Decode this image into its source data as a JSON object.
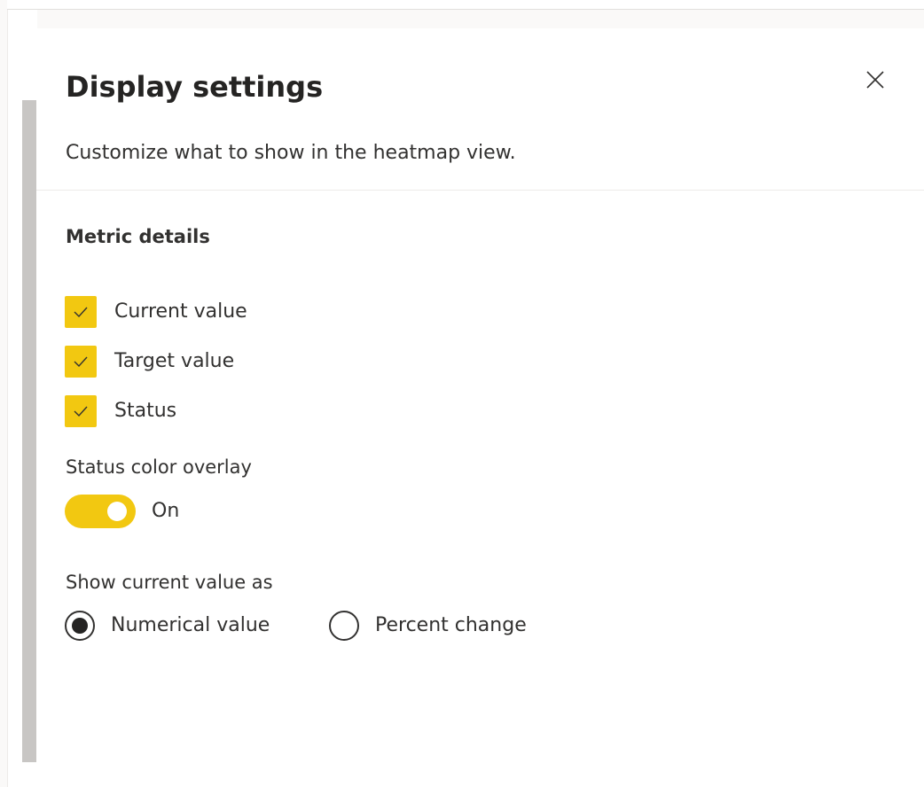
{
  "panel": {
    "title": "Display settings",
    "subtitle": "Customize what to show in the heatmap view.",
    "close_icon": "close-icon"
  },
  "metric_details": {
    "label": "Metric details",
    "options": [
      {
        "label": "Current value",
        "checked": true
      },
      {
        "label": "Target value",
        "checked": true
      },
      {
        "label": "Status",
        "checked": true
      }
    ]
  },
  "status_overlay": {
    "label": "Status color overlay",
    "state_label": "On",
    "on": true
  },
  "current_value_as": {
    "label": "Show current value as",
    "options": [
      {
        "label": "Numerical value",
        "selected": true
      },
      {
        "label": "Percent change",
        "selected": false
      }
    ]
  },
  "colors": {
    "accent": "#f2c811",
    "text": "#323130",
    "divider": "#edebe9",
    "scrollbar": "#c8c6c4"
  }
}
